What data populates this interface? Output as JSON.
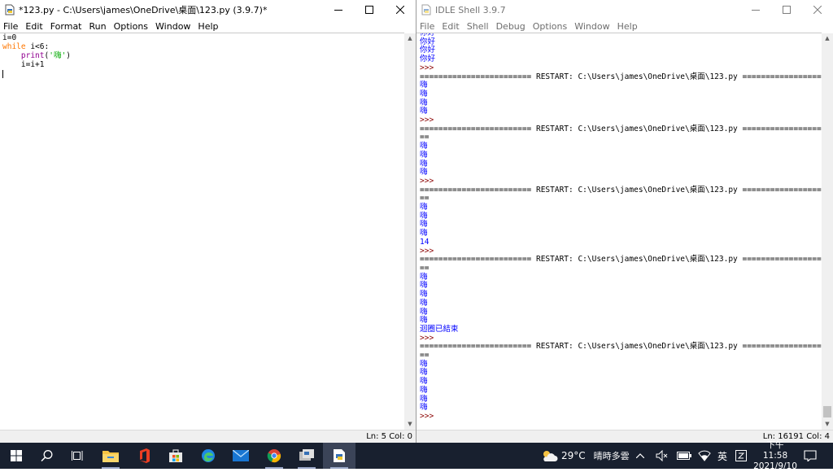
{
  "left": {
    "title": "*123.py - C:\\Users\\james\\OneDrive\\桌面\\123.py (3.9.7)*",
    "menu": [
      "File",
      "Edit",
      "Format",
      "Run",
      "Options",
      "Window",
      "Help"
    ],
    "code": {
      "l1": "i=0",
      "l2_kw": "while",
      "l2_rest": " i<6:",
      "l3_indent": "    ",
      "l3_bi": "print",
      "l3_open": "(",
      "l3_str": "'嗨'",
      "l3_close": ")",
      "l4": "    i=i+1"
    },
    "status": "Ln: 5   Col: 0"
  },
  "right": {
    "title": "IDLE Shell 3.9.7",
    "menu": [
      "File",
      "Edit",
      "Shell",
      "Debug",
      "Options",
      "Window",
      "Help"
    ],
    "status": "Ln: 16191   Col: 4",
    "restart": "======================== RESTART: C:\\Users\\james\\OneDrive\\桌面\\123.py =======================",
    "wrap": "==",
    "prompt": ">>>",
    "hi": "你好",
    "hey": "嗨",
    "fourteen": "14",
    "ended": "迴圈已結束"
  },
  "taskbar": {
    "weather_temp": "29°C",
    "weather_text": "晴時多雲",
    "ime": "英",
    "time": "下午 11:58",
    "date": "2021/9/10"
  },
  "icons": [
    "windows-start-icon",
    "search-icon",
    "task-view-icon",
    "file-explorer-icon",
    "office-icon",
    "store-icon",
    "edge-icon",
    "mail-icon",
    "chrome-icon",
    "python-idle-icon",
    "idle-editor-icon"
  ]
}
